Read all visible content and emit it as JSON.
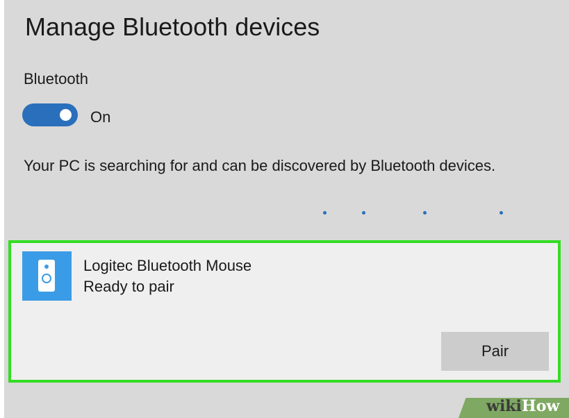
{
  "page": {
    "title": "Manage Bluetooth devices"
  },
  "bluetooth": {
    "label": "Bluetooth",
    "toggle_state": "On",
    "toggle_on": true,
    "searching_text": "Your PC is searching for and can be discovered by Bluetooth devices."
  },
  "device": {
    "name": "Logitec Bluetooth Mouse",
    "status": "Ready to pair",
    "icon": "speaker-icon",
    "pair_label": "Pair"
  },
  "watermark": {
    "wiki": "wiki",
    "how": "How"
  },
  "colors": {
    "accent": "#2a6fbb",
    "highlight": "#33dd22",
    "device_icon_bg": "#3a9ce6"
  }
}
